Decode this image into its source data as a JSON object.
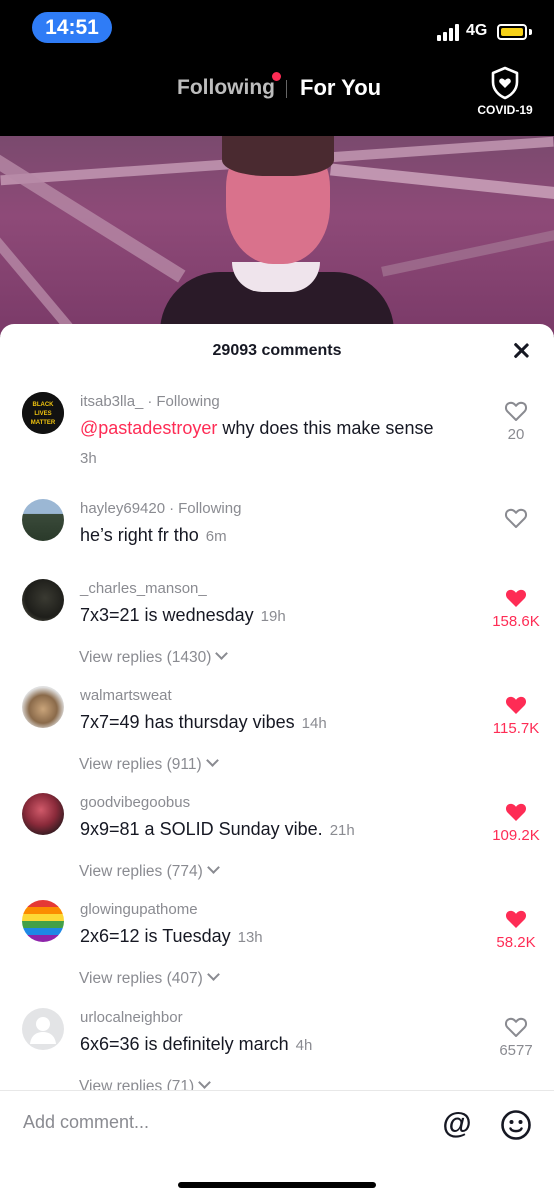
{
  "status_bar": {
    "time": "14:51",
    "network": "4G",
    "colors": {
      "time_pill": "#2f7cf6",
      "battery": "#f6d118"
    }
  },
  "top_nav": {
    "following_label": "Following",
    "for_you_label": "For You",
    "covid_label": "COVID-19"
  },
  "comments_sheet": {
    "title": "29093 comments",
    "comments": [
      {
        "username": "itsab3lla_",
        "following_label": "Following",
        "mention": "@pastadestroyer",
        "text": "why does this make sense",
        "time": "3h",
        "likes": "20",
        "liked": false
      },
      {
        "username": "hayley69420",
        "following_label": "Following",
        "text": "he’s right fr tho",
        "time": "6m",
        "likes": "",
        "liked": false
      },
      {
        "username": "_charles_manson_",
        "text": "7x3=21 is wednesday",
        "time": "19h",
        "likes": "158.6K",
        "liked": true,
        "replies": "View replies (1430)"
      },
      {
        "username": "walmartsweat",
        "text": "7x7=49 has thursday vibes",
        "time": "14h",
        "likes": "115.7K",
        "liked": true,
        "replies": "View replies (911)"
      },
      {
        "username": "goodvibegoobus",
        "text": "9x9=81 a SOLID Sunday vibe.",
        "time": "21h",
        "likes": "109.2K",
        "liked": true,
        "replies": "View replies (774)"
      },
      {
        "username": "glowingupathome",
        "text": "2x6=12 is Tuesday",
        "time": "13h",
        "likes": "58.2K",
        "liked": true,
        "replies": "View replies (407)"
      },
      {
        "username": "urlocalneighbor",
        "text": "6x6=36 is definitely march",
        "time": "4h",
        "likes": "6577",
        "liked": false,
        "replies": "View replies (71)"
      }
    ],
    "avatar_badge_text": "BLACK LIVES MATTER"
  },
  "input": {
    "placeholder": "Add comment...",
    "at_symbol": "@"
  },
  "colors": {
    "accent": "#fe2c55",
    "muted_text": "#8a8b91",
    "primary_text": "#161823"
  }
}
